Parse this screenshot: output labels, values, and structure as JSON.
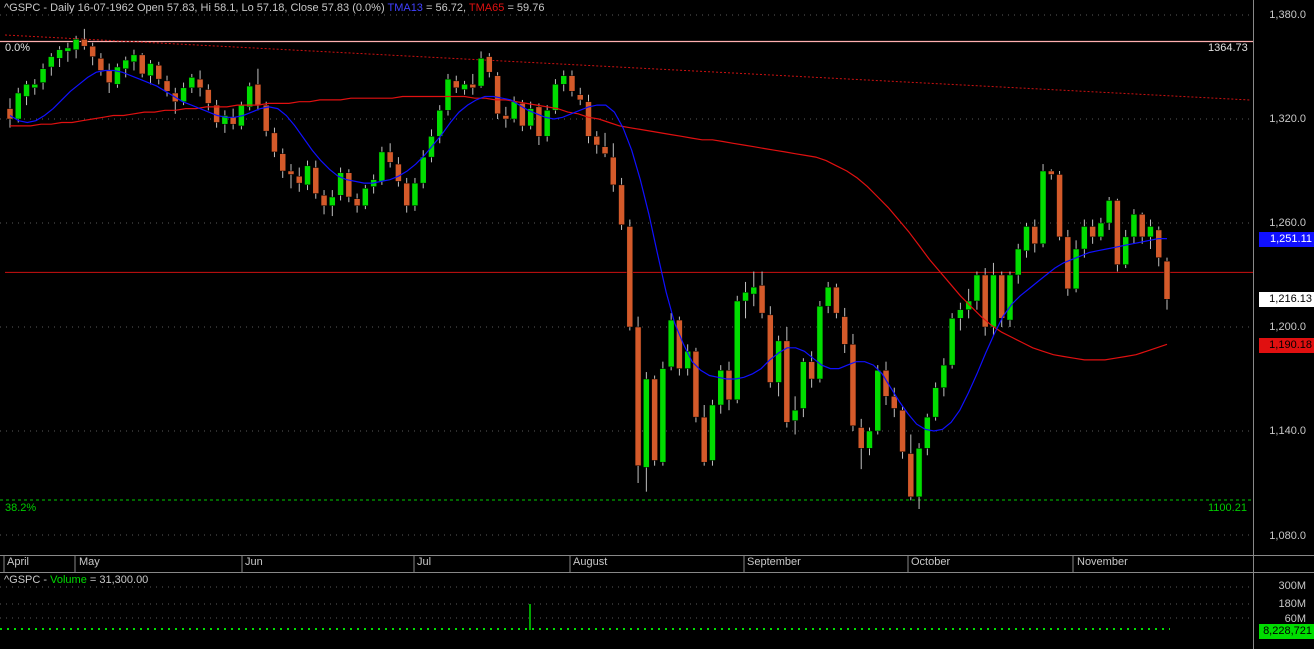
{
  "header": {
    "symbol_info": "^GSPC - Daily 16-07-1962 Open 57.83, Hi 58.1, Lo 57.18, Close 57.83 (0.0%)",
    "tma13_label": "TMA13",
    "tma13_value": " = 56.72,",
    "tma65_label": "TMA65",
    "tma65_value": " = 59.76"
  },
  "volume_header": {
    "prefix": "^GSPC - ",
    "label": "Volume",
    "value": " = 31,300.00"
  },
  "fib": {
    "top_pct": "0.0%",
    "top_value": "1364.73",
    "low_pct": "38.2%",
    "low_value": "1100.21"
  },
  "tags": {
    "tma13": "1,251.11",
    "last": "1,216.13",
    "tma65": "1,190.18",
    "volume": "8,228,721"
  },
  "volume_ticks": [
    "300M",
    "180M",
    "60M"
  ],
  "colors": {
    "up": "#00dd00",
    "down": "#d45a2a",
    "tma13": "#1010ff",
    "tma65": "#e01010",
    "fib_top": "#ffb0b0",
    "fib_low": "#00cc00"
  },
  "chart_data": {
    "type": "candlestick",
    "title": "^GSPC - Daily",
    "y_ticks": [
      "1,380.0",
      "1,320.0",
      "1,260.0",
      "1,200.0",
      "1,140.0",
      "1,080.0"
    ],
    "ylim": [
      1070,
      1385
    ],
    "months": [
      "April",
      "May",
      "Jun",
      "Jul",
      "August",
      "September",
      "October",
      "November"
    ],
    "fib_levels": [
      1364.73,
      1100.21
    ],
    "horizontal_line": 1231.5,
    "ohlc": [
      [
        1326,
        1332,
        1315,
        1320
      ],
      [
        1320,
        1338,
        1318,
        1335
      ],
      [
        1333,
        1342,
        1328,
        1340
      ],
      [
        1338,
        1343,
        1334,
        1340
      ],
      [
        1341,
        1352,
        1337,
        1349
      ],
      [
        1350,
        1358,
        1345,
        1356
      ],
      [
        1355,
        1362,
        1350,
        1360
      ],
      [
        1359,
        1364,
        1353,
        1361
      ],
      [
        1360,
        1368,
        1355,
        1366
      ],
      [
        1366,
        1372,
        1360,
        1362
      ],
      [
        1362,
        1364,
        1351,
        1356
      ],
      [
        1355,
        1358,
        1345,
        1348
      ],
      [
        1348,
        1352,
        1335,
        1341
      ],
      [
        1340,
        1352,
        1338,
        1350
      ],
      [
        1349,
        1356,
        1344,
        1354
      ],
      [
        1353,
        1360,
        1348,
        1357
      ],
      [
        1357,
        1358,
        1344,
        1346
      ],
      [
        1345,
        1354,
        1340,
        1352
      ],
      [
        1351,
        1353,
        1340,
        1343
      ],
      [
        1342,
        1345,
        1333,
        1336
      ],
      [
        1335,
        1338,
        1323,
        1330
      ],
      [
        1330,
        1341,
        1328,
        1338
      ],
      [
        1338,
        1346,
        1335,
        1344
      ],
      [
        1343,
        1348,
        1333,
        1338
      ],
      [
        1337,
        1340,
        1325,
        1329
      ],
      [
        1328,
        1331,
        1315,
        1318
      ],
      [
        1317,
        1325,
        1312,
        1322
      ],
      [
        1321,
        1326,
        1314,
        1317
      ],
      [
        1316,
        1330,
        1314,
        1328
      ],
      [
        1327,
        1341,
        1325,
        1339
      ],
      [
        1340,
        1349,
        1325,
        1328
      ],
      [
        1328,
        1330,
        1310,
        1313
      ],
      [
        1312,
        1315,
        1298,
        1301
      ],
      [
        1300,
        1303,
        1286,
        1290
      ],
      [
        1290,
        1294,
        1280,
        1288
      ],
      [
        1287,
        1292,
        1278,
        1283
      ],
      [
        1282,
        1296,
        1279,
        1293
      ],
      [
        1292,
        1296,
        1274,
        1277
      ],
      [
        1276,
        1279,
        1265,
        1270
      ],
      [
        1270,
        1279,
        1264,
        1275
      ],
      [
        1276,
        1292,
        1273,
        1289
      ],
      [
        1289,
        1291,
        1272,
        1275
      ],
      [
        1274,
        1277,
        1266,
        1270
      ],
      [
        1270,
        1282,
        1268,
        1280
      ],
      [
        1281,
        1288,
        1277,
        1285
      ],
      [
        1284,
        1304,
        1282,
        1301
      ],
      [
        1301,
        1306,
        1292,
        1295
      ],
      [
        1294,
        1298,
        1281,
        1284
      ],
      [
        1283,
        1286,
        1266,
        1270
      ],
      [
        1270,
        1286,
        1267,
        1283
      ],
      [
        1283,
        1302,
        1280,
        1298
      ],
      [
        1298,
        1314,
        1295,
        1310
      ],
      [
        1310,
        1328,
        1306,
        1325
      ],
      [
        1325,
        1346,
        1322,
        1343
      ],
      [
        1342,
        1345,
        1335,
        1338
      ],
      [
        1337,
        1342,
        1334,
        1340
      ],
      [
        1340,
        1346,
        1334,
        1338
      ],
      [
        1339,
        1359,
        1338,
        1355
      ],
      [
        1356,
        1358,
        1344,
        1347
      ],
      [
        1345,
        1347,
        1320,
        1323
      ],
      [
        1322,
        1327,
        1315,
        1320
      ],
      [
        1320,
        1333,
        1318,
        1330
      ],
      [
        1329,
        1331,
        1313,
        1316
      ],
      [
        1316,
        1330,
        1314,
        1326
      ],
      [
        1327,
        1329,
        1305,
        1310
      ],
      [
        1310,
        1328,
        1307,
        1325
      ],
      [
        1325,
        1343,
        1323,
        1340
      ],
      [
        1340,
        1348,
        1336,
        1345
      ],
      [
        1345,
        1348,
        1333,
        1336
      ],
      [
        1334,
        1338,
        1328,
        1331
      ],
      [
        1330,
        1334,
        1306,
        1310
      ],
      [
        1310,
        1313,
        1300,
        1305
      ],
      [
        1304,
        1312,
        1298,
        1300
      ],
      [
        1298,
        1306,
        1278,
        1282
      ],
      [
        1282,
        1286,
        1256,
        1259
      ],
      [
        1258,
        1262,
        1198,
        1200
      ],
      [
        1200,
        1206,
        1110,
        1120
      ],
      [
        1119,
        1174,
        1105,
        1170
      ],
      [
        1170,
        1172,
        1120,
        1123
      ],
      [
        1122,
        1180,
        1120,
        1176
      ],
      [
        1177,
        1208,
        1175,
        1204
      ],
      [
        1204,
        1206,
        1172,
        1176
      ],
      [
        1176,
        1190,
        1172,
        1186
      ],
      [
        1186,
        1188,
        1145,
        1148
      ],
      [
        1148,
        1155,
        1120,
        1122
      ],
      [
        1123,
        1158,
        1120,
        1155
      ],
      [
        1155,
        1178,
        1150,
        1175
      ],
      [
        1175,
        1180,
        1152,
        1158
      ],
      [
        1158,
        1218,
        1156,
        1215
      ],
      [
        1215,
        1226,
        1205,
        1220
      ],
      [
        1219,
        1232,
        1212,
        1223
      ],
      [
        1224,
        1232,
        1205,
        1208
      ],
      [
        1207,
        1212,
        1165,
        1168
      ],
      [
        1168,
        1195,
        1160,
        1192
      ],
      [
        1192,
        1200,
        1142,
        1145
      ],
      [
        1146,
        1160,
        1138,
        1152
      ],
      [
        1153,
        1182,
        1148,
        1180
      ],
      [
        1180,
        1186,
        1165,
        1170
      ],
      [
        1170,
        1215,
        1168,
        1212
      ],
      [
        1212,
        1226,
        1208,
        1223
      ],
      [
        1223,
        1225,
        1205,
        1208
      ],
      [
        1206,
        1211,
        1185,
        1190
      ],
      [
        1190,
        1196,
        1140,
        1143
      ],
      [
        1142,
        1147,
        1118,
        1130
      ],
      [
        1130,
        1142,
        1126,
        1140
      ],
      [
        1140,
        1178,
        1138,
        1175
      ],
      [
        1175,
        1180,
        1155,
        1160
      ],
      [
        1160,
        1165,
        1148,
        1153
      ],
      [
        1152,
        1154,
        1124,
        1128
      ],
      [
        1127,
        1138,
        1100,
        1102
      ],
      [
        1102,
        1133,
        1095,
        1130
      ],
      [
        1130,
        1150,
        1126,
        1148
      ],
      [
        1148,
        1168,
        1146,
        1165
      ],
      [
        1165,
        1182,
        1160,
        1178
      ],
      [
        1178,
        1208,
        1176,
        1205
      ],
      [
        1205,
        1214,
        1198,
        1210
      ],
      [
        1210,
        1222,
        1205,
        1215
      ],
      [
        1215,
        1232,
        1210,
        1230
      ],
      [
        1230,
        1234,
        1195,
        1200
      ],
      [
        1200,
        1237,
        1195,
        1230
      ],
      [
        1230,
        1232,
        1200,
        1205
      ],
      [
        1204,
        1232,
        1200,
        1230
      ],
      [
        1230,
        1248,
        1225,
        1245
      ],
      [
        1244,
        1260,
        1240,
        1258
      ],
      [
        1258,
        1262,
        1243,
        1248
      ],
      [
        1248,
        1294,
        1246,
        1290
      ],
      [
        1290,
        1291,
        1285,
        1288
      ],
      [
        1288,
        1290,
        1250,
        1252
      ],
      [
        1252,
        1256,
        1218,
        1222
      ],
      [
        1222,
        1250,
        1220,
        1245
      ],
      [
        1245,
        1262,
        1240,
        1258
      ],
      [
        1258,
        1262,
        1248,
        1252
      ],
      [
        1252,
        1263,
        1250,
        1260
      ],
      [
        1260,
        1275,
        1256,
        1273
      ],
      [
        1273,
        1274,
        1232,
        1236
      ],
      [
        1236,
        1256,
        1234,
        1252
      ],
      [
        1252,
        1268,
        1248,
        1265
      ],
      [
        1265,
        1266,
        1248,
        1252
      ],
      [
        1252,
        1262,
        1245,
        1258
      ],
      [
        1256,
        1258,
        1235,
        1240
      ],
      [
        1238,
        1240,
        1210,
        1216
      ]
    ],
    "tma13": [
      1322,
      1319,
      1318,
      1319,
      1322,
      1326,
      1331,
      1336,
      1340,
      1344,
      1347,
      1348,
      1348,
      1347,
      1345,
      1343,
      1341,
      1339,
      1336,
      1333,
      1330,
      1328,
      1326,
      1324,
      1322,
      1321,
      1321,
      1322,
      1324,
      1326,
      1327,
      1326,
      1322,
      1316,
      1309,
      1302,
      1296,
      1291,
      1287,
      1285,
      1284,
      1283,
      1283,
      1284,
      1285,
      1287,
      1290,
      1294,
      1299,
      1305,
      1311,
      1318,
      1324,
      1328,
      1331,
      1333,
      1333,
      1332,
      1331,
      1328,
      1325,
      1323,
      1321,
      1320,
      1321,
      1323,
      1325,
      1327,
      1328,
      1328,
      1324,
      1315,
      1302,
      1285,
      1265,
      1242,
      1220,
      1202,
      1190,
      1180,
      1175,
      1172,
      1171,
      1170,
      1170,
      1171,
      1173,
      1176,
      1181,
      1185,
      1188,
      1188,
      1186,
      1182,
      1178,
      1176,
      1176,
      1178,
      1180,
      1180,
      1178,
      1173,
      1165,
      1157,
      1150,
      1144,
      1141,
      1140,
      1141,
      1145,
      1152,
      1162,
      1173,
      1185,
      1196,
      1206,
      1213,
      1218,
      1222,
      1226,
      1230,
      1234,
      1237,
      1239,
      1241,
      1243,
      1244,
      1245,
      1246,
      1247,
      1248,
      1249,
      1250,
      1251,
      1251
    ],
    "tma65": [
      1316,
      1316,
      1316,
      1317,
      1317,
      1318,
      1318,
      1319,
      1320,
      1321,
      1322,
      1322,
      1323,
      1324,
      1324,
      1325,
      1325,
      1326,
      1326,
      1327,
      1327,
      1327,
      1328,
      1328,
      1328,
      1329,
      1329,
      1329,
      1330,
      1330,
      1331,
      1331,
      1331,
      1332,
      1332,
      1332,
      1332,
      1332,
      1333,
      1333,
      1333,
      1333,
      1333,
      1333,
      1333,
      1332,
      1332,
      1331,
      1331,
      1330,
      1329,
      1328,
      1327,
      1326,
      1324,
      1323,
      1321,
      1320,
      1318,
      1316,
      1315,
      1314,
      1313,
      1312,
      1311,
      1310,
      1309,
      1308,
      1308,
      1307,
      1306,
      1305,
      1304,
      1303,
      1302,
      1301,
      1300,
      1299,
      1298,
      1296,
      1293,
      1290,
      1286,
      1281,
      1275,
      1269,
      1262,
      1255,
      1247,
      1239,
      1232,
      1225,
      1218,
      1212,
      1206,
      1201,
      1197,
      1194,
      1191,
      1188,
      1186,
      1184,
      1183,
      1182,
      1181,
      1181,
      1181,
      1182,
      1183,
      1184,
      1186,
      1188,
      1190
    ]
  }
}
